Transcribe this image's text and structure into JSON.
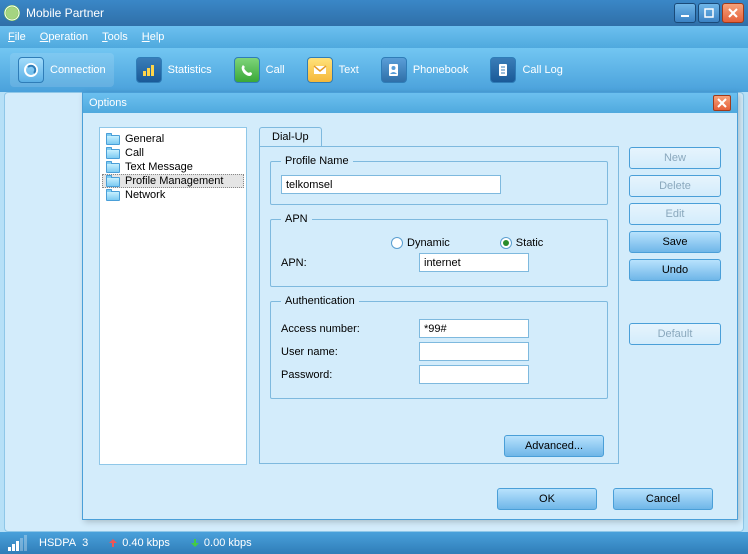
{
  "app": {
    "title": "Mobile Partner"
  },
  "menu": {
    "file": "File",
    "operation": "Operation",
    "tools": "Tools",
    "help": "Help"
  },
  "toolbar": {
    "connection": "Connection",
    "statistics": "Statistics",
    "call": "Call",
    "text": "Text",
    "phonebook": "Phonebook",
    "calllog": "Call Log"
  },
  "status": {
    "mode": "HSDPA",
    "bars": "3",
    "up_kbps": "0.40 kbps",
    "down_kbps": "0.00 kbps"
  },
  "dialog": {
    "title": "Options",
    "tree": {
      "general": "General",
      "call": "Call",
      "text_message": "Text Message",
      "profile_management": "Profile Management",
      "network": "Network"
    },
    "tab": "Dial-Up",
    "profile_name_legend": "Profile Name",
    "profile_name_value": "telkomsel",
    "apn_legend": "APN",
    "apn_dynamic": "Dynamic",
    "apn_static": "Static",
    "apn_label": "APN:",
    "apn_value": "internet",
    "auth_legend": "Authentication",
    "access_number_label": "Access number:",
    "access_number_value": "*99#",
    "user_name_label": "User name:",
    "user_name_value": "",
    "password_label": "Password:",
    "password_value": "",
    "advanced": "Advanced...",
    "buttons": {
      "new": "New",
      "delete": "Delete",
      "edit": "Edit",
      "save": "Save",
      "undo": "Undo",
      "default": "Default",
      "ok": "OK",
      "cancel": "Cancel"
    }
  }
}
